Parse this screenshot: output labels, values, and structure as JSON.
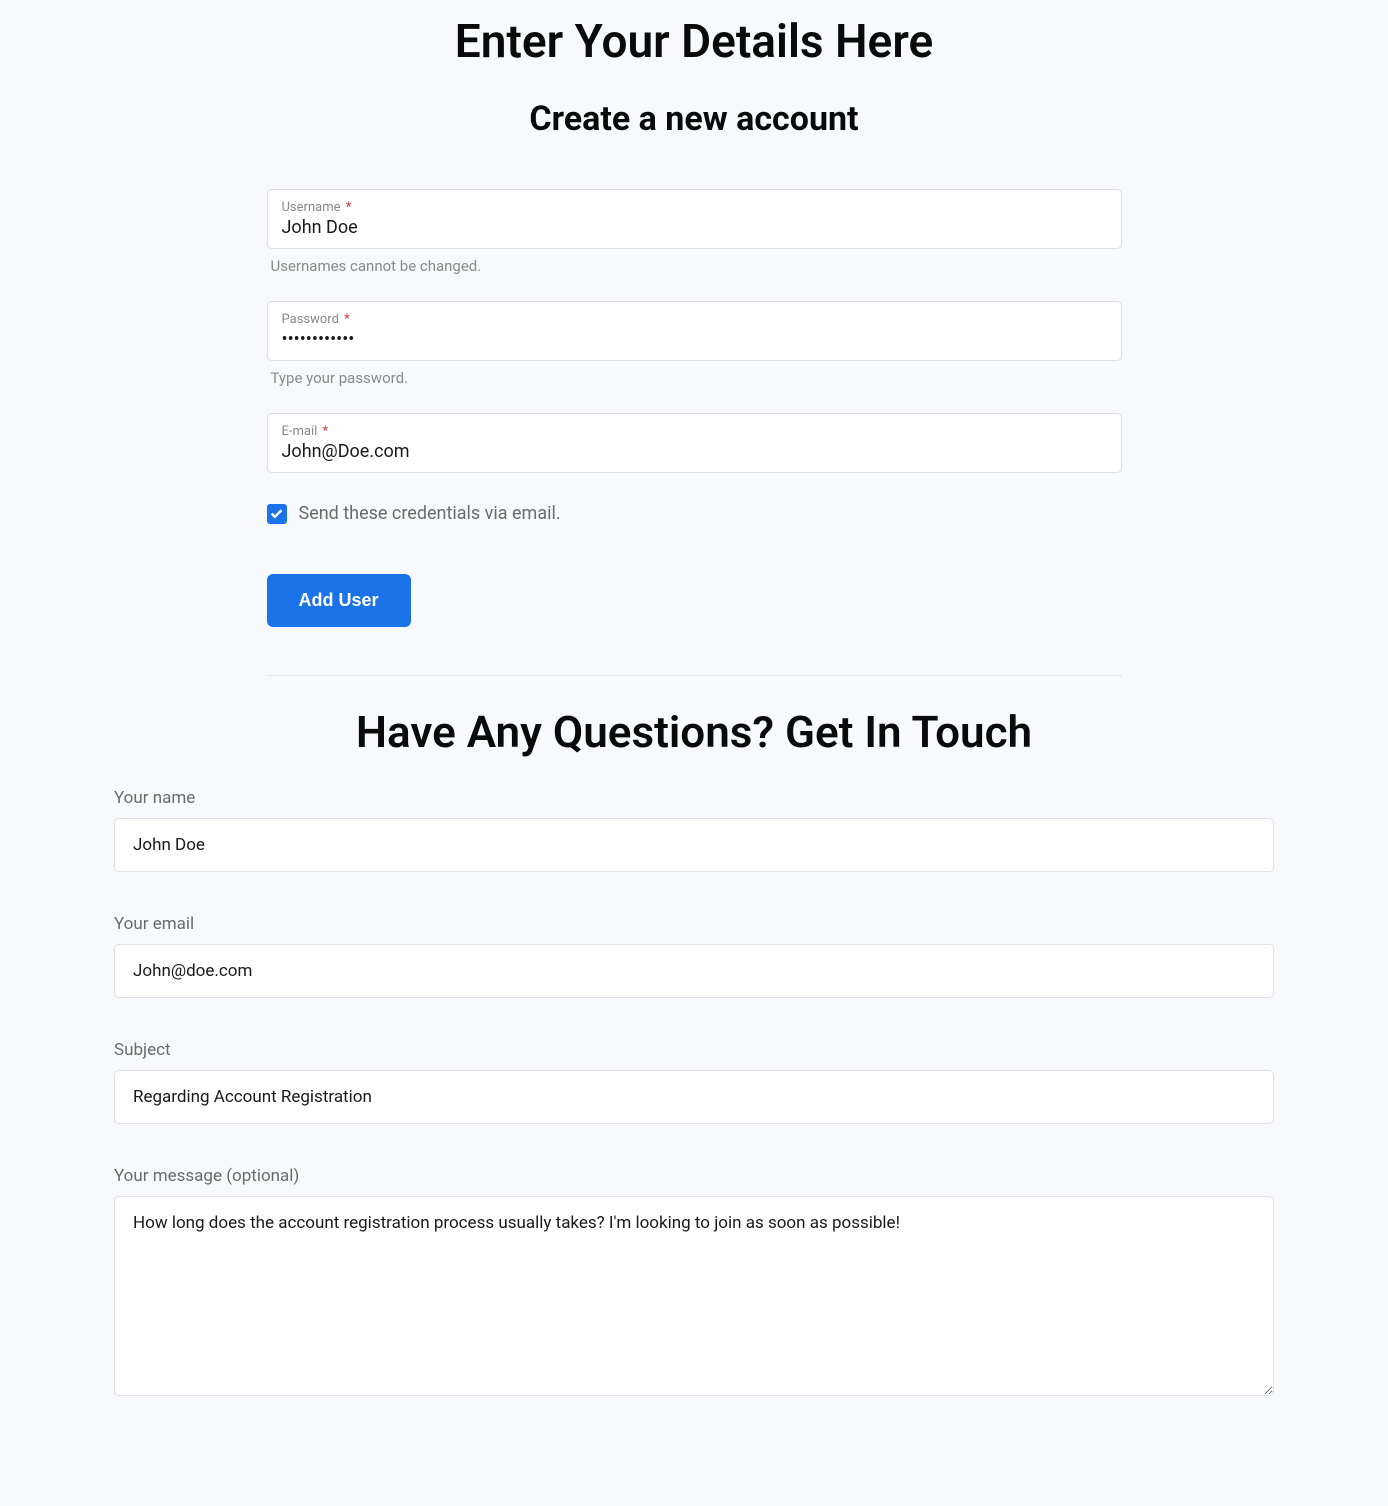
{
  "header": {
    "main_title": "Enter Your Details Here",
    "subtitle": "Create a new account"
  },
  "register": {
    "username_label": "Username",
    "username_value": "John Doe",
    "username_helper": "Usernames cannot be changed.",
    "password_label": "Password",
    "password_value": "••••••••••••",
    "password_helper": "Type your password.",
    "email_label": "E-mail",
    "email_value": "John@Doe.com",
    "checkbox_label": "Send these credentials via email.",
    "submit_label": "Add User",
    "required_mark": "*"
  },
  "contact": {
    "title": "Have Any Questions? Get In Touch",
    "name_label": "Your name",
    "name_value": "John Doe",
    "email_label": "Your email",
    "email_value": "John@doe.com",
    "subject_label": "Subject",
    "subject_value": "Regarding Account Registration",
    "message_label": "Your message (optional)",
    "message_value": "How long does the account registration process usually takes? I'm looking to join as soon as possible!"
  }
}
